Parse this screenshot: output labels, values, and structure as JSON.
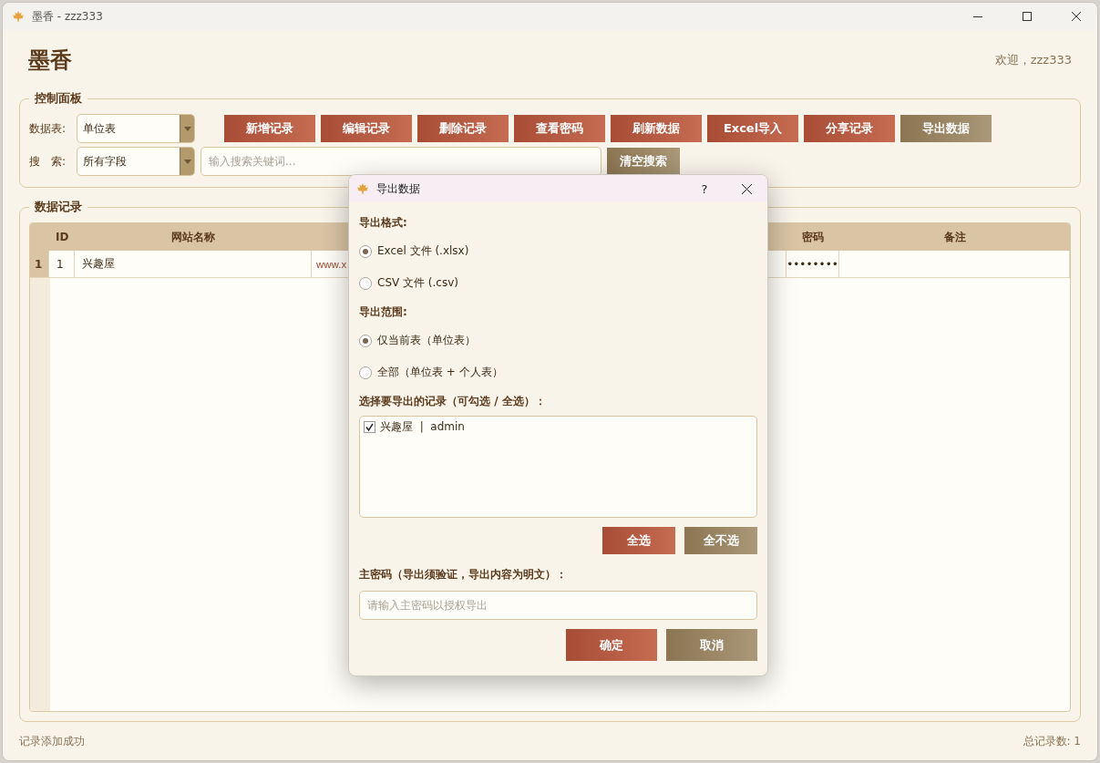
{
  "window": {
    "title": "墨香 - zzz333"
  },
  "header": {
    "app_name": "墨香",
    "welcome": "欢迎，zzz333"
  },
  "control_panel": {
    "legend": "控制面板",
    "table_label": "数据表:",
    "table_select": "单位表",
    "buttons": [
      {
        "label": "新增记录",
        "kind": "primary"
      },
      {
        "label": "编辑记录",
        "kind": "primary"
      },
      {
        "label": "删除记录",
        "kind": "primary"
      },
      {
        "label": "查看密码",
        "kind": "primary"
      },
      {
        "label": "刷新数据",
        "kind": "primary"
      },
      {
        "label": "Excel导入",
        "kind": "primary"
      },
      {
        "label": "分享记录",
        "kind": "primary"
      },
      {
        "label": "导出数据",
        "kind": "secondary"
      }
    ],
    "search_label": "搜　索:",
    "search_select": "所有字段",
    "search": {
      "placeholder": "输入搜索关键词..."
    },
    "clear_button": {
      "label": "清空搜索",
      "kind": "secondary"
    }
  },
  "records": {
    "legend": "数据记录",
    "table": {
      "columns": [
        "ID",
        "网站名称",
        "密码",
        "备注"
      ],
      "rows": [
        {
          "row_number": "1",
          "id": "1",
          "site_name": "兴趣屋",
          "column_3": "www.x",
          "password": "••••••••"
        }
      ]
    }
  },
  "status_bar": {
    "message": "记录添加成功",
    "total": "总记录数: 1"
  },
  "dialog": {
    "title": "导出数据",
    "help": "?",
    "format_label": "导出格式:",
    "formats": [
      {
        "label": "Excel 文件 (.xlsx)",
        "selected": true
      },
      {
        "label": "CSV 文件 (.csv)",
        "selected": false
      }
    ],
    "scope_label": "导出范围:",
    "scopes": [
      {
        "label": "仅当前表（单位表）",
        "selected": true
      },
      {
        "label": "全部（单位表 + 个人表）",
        "selected": false
      }
    ],
    "records_label": "选择要导出的记录（可勾选 / 全选）：",
    "records": [
      {
        "label": "兴趣屋  |  admin",
        "checked": true
      }
    ],
    "select_buttons": [
      {
        "label": "全选",
        "kind": "primary"
      },
      {
        "label": "全不选",
        "kind": "secondary"
      }
    ],
    "password_label": "主密码（导出须验证，导出内容为明文）：",
    "password": {
      "placeholder": "请输入主密码以授权导出"
    },
    "buttons": [
      {
        "label": "确定",
        "kind": "primary"
      },
      {
        "label": "取消",
        "kind": "secondary"
      }
    ]
  }
}
